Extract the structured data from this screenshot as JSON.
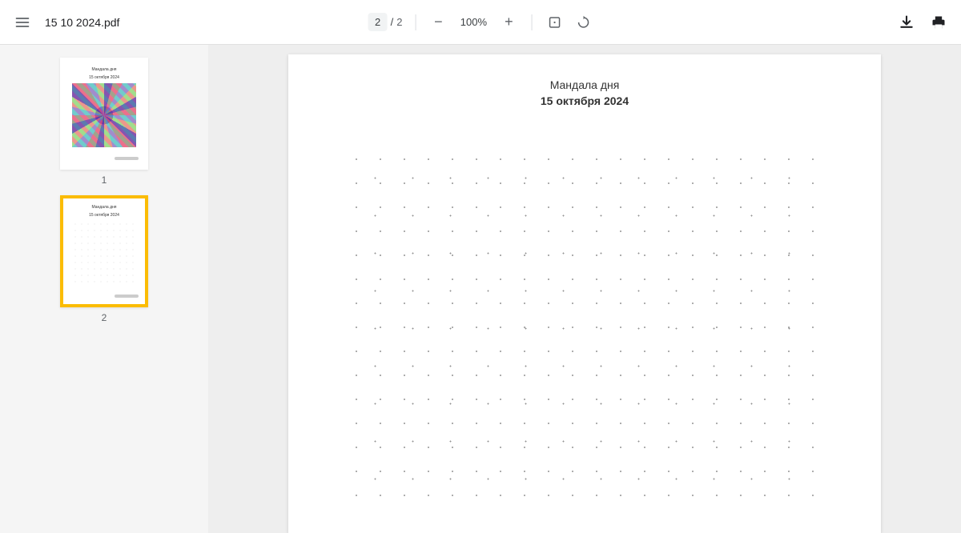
{
  "file": {
    "name": "15 10 2024.pdf"
  },
  "pagination": {
    "current": "2",
    "separator": "/",
    "total": "2"
  },
  "zoom": {
    "value": "100%"
  },
  "thumbnails": [
    {
      "label": "1",
      "selected": false
    },
    {
      "label": "2",
      "selected": true
    }
  ],
  "document": {
    "heading": "Мандала дня",
    "date": "15 октября 2024"
  },
  "icons": {
    "menu": "menu",
    "zoom_out": "−",
    "zoom_in": "+",
    "fit": "fit",
    "rotate": "rotate",
    "download": "download",
    "print": "print"
  }
}
